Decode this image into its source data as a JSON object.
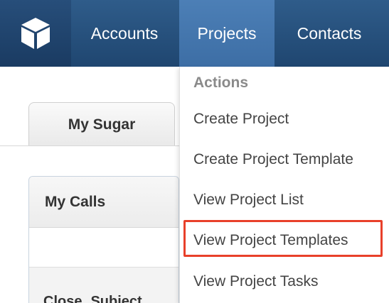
{
  "nav": {
    "logo_icon": "cube-icon",
    "items": [
      "Accounts",
      "Projects",
      "Contacts"
    ],
    "active": "Projects"
  },
  "page": {
    "tab_label": "My Sugar",
    "dashlet_title": "My Calls",
    "columns": [
      "Close",
      "Subject"
    ]
  },
  "dropdown": {
    "section_label": "Actions",
    "items": [
      "Create Project",
      "Create Project Template",
      "View Project List",
      "View Project Templates",
      "View Project Tasks"
    ],
    "highlighted_item": "View Project Templates",
    "highlight_color": "#e8402a"
  }
}
